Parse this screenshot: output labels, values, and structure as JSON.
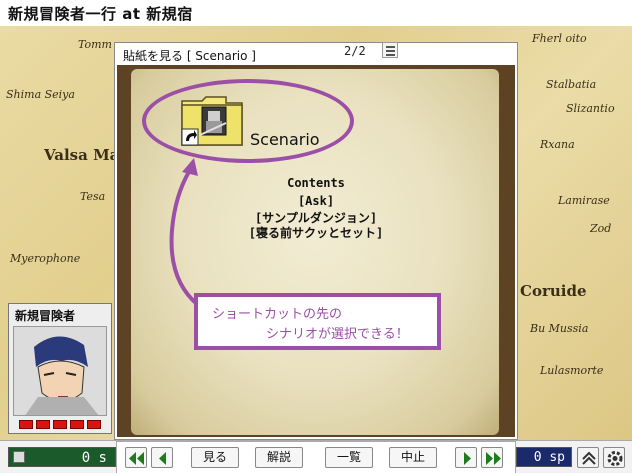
{
  "window": {
    "title": "新規冒険者一行 at 新規宿"
  },
  "map": {
    "labels": [
      "Tomm",
      "Shima Seiya",
      "Valsa Ma",
      "Tesa",
      "Myerophone",
      "Fherl oito",
      "Stalbatia",
      "Slizantio",
      "Rxana",
      "Lamirase",
      "Zod",
      "Coruide",
      "Bu Mussia",
      "Lulasmorte"
    ]
  },
  "dialog": {
    "title": "貼紙を見る [ Scenario ]",
    "page": "2/2",
    "scenario_label": "Scenario",
    "contents_heading": "Contents",
    "contents_lines": [
      "[Ask]",
      "[サンプルダンジョン]",
      "[寝る前サクッとセット]"
    ]
  },
  "callout": {
    "line1": "ショートカットの先の",
    "line2": "シナリオが選択できる！",
    "color": "#9b4fa6"
  },
  "party": {
    "name": "新規冒険者"
  },
  "bottombar": {
    "left_counter": "0 s",
    "buttons": {
      "view": "見る",
      "explain": "解説",
      "list": "一覧",
      "stop": "中止"
    },
    "sp_counter": "0 sp"
  },
  "colors": {
    "accent": "#9b4fa6",
    "parchment": "#ebdca8",
    "wood": "#5e4224"
  },
  "icons": [
    "folder-icon",
    "shortcut-arrow-icon",
    "knight-icon",
    "list-icon",
    "double-left-icon",
    "left-icon",
    "right-icon",
    "double-right-icon",
    "up-chevron-icon",
    "gear-icon"
  ]
}
